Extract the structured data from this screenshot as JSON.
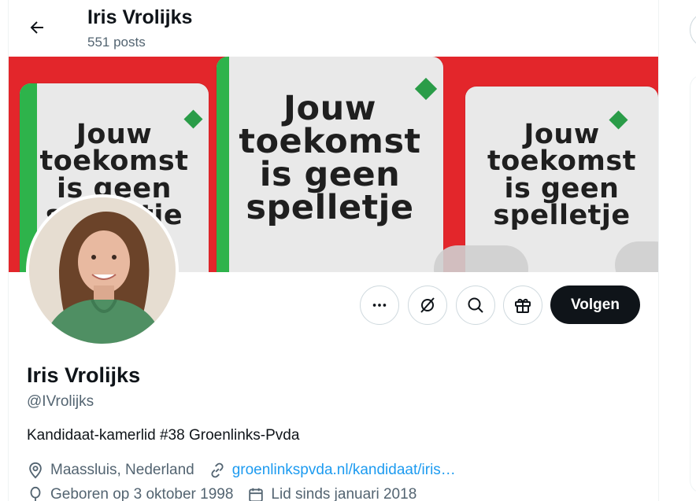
{
  "header": {
    "back_icon": "arrow-left-icon",
    "name": "Iris Vrolijks",
    "posts": "551 posts"
  },
  "banner": {
    "cards": [
      {
        "text_lines": [
          "Jouw",
          "toekomst",
          "is geen",
          "spelletje"
        ]
      },
      {
        "text_lines": [
          "Jouw",
          "toekomst",
          "is geen",
          "spelletje"
        ]
      },
      {
        "text_lines": [
          "Jouw",
          "toekomst",
          "is geen",
          "spelletje"
        ]
      }
    ],
    "colors": {
      "background": "#e3262b",
      "card": "#e9e9e9",
      "stripe": "#2eb34b",
      "diamond": "#2a9c48"
    }
  },
  "actions": {
    "more_icon": "more-horizontal-icon",
    "grok_icon": "grok-icon",
    "search_icon": "search-icon",
    "gift_icon": "gift-icon",
    "follow_label": "Volgen"
  },
  "profile": {
    "name": "Iris Vrolijks",
    "handle": "@IVrolijks",
    "bio": "Kandidaat-kamerlid #38 Groenlinks-Pvda",
    "location": "Maassluis, Nederland",
    "website": "groenlinkspvda.nl/kandidaat/iris…",
    "birthday": "Geboren op 3 oktober 1998",
    "joined": "Lid sinds januari 2018"
  },
  "colors": {
    "accent": "#1d9bf0",
    "text": "#0f1419",
    "muted": "#536471",
    "follow_bg": "#0f1419"
  }
}
